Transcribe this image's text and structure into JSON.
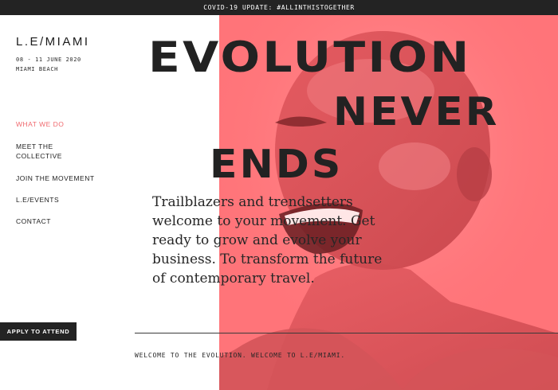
{
  "banner": {
    "text": "COVID-19 UPDATE: #ALLINTHISTOGETHER"
  },
  "brand": {
    "logo": "L.E/MIAMI",
    "dates": "08 - 11 JUNE 2020",
    "location": "MIAMI BEACH"
  },
  "nav": {
    "items": [
      {
        "label": "WHAT WE DO",
        "active": true
      },
      {
        "label": "MEET THE\nCOLLECTIVE",
        "active": false
      },
      {
        "label": "JOIN THE MOVEMENT",
        "active": false
      },
      {
        "label": "L.E/EVENTS",
        "active": false
      },
      {
        "label": "CONTACT",
        "active": false
      }
    ]
  },
  "hero": {
    "headline": [
      "EVOLUTION",
      "NEVER",
      "ENDS"
    ],
    "intro": "Trailblazers and trendsetters welcome to your movement. Get ready to grow and evolve your business. To transform the future of contemporary travel.",
    "footer": "WELCOME TO THE EVOLUTION. WELCOME TO L.E/MIAMI.",
    "image": "duotone portrait photo"
  },
  "cta": {
    "label": "APPLY TO ATTEND"
  },
  "colors": {
    "accent": "#ff6f74",
    "accent_dark": "#c8464c",
    "text": "#222222",
    "bar": "#232323"
  }
}
